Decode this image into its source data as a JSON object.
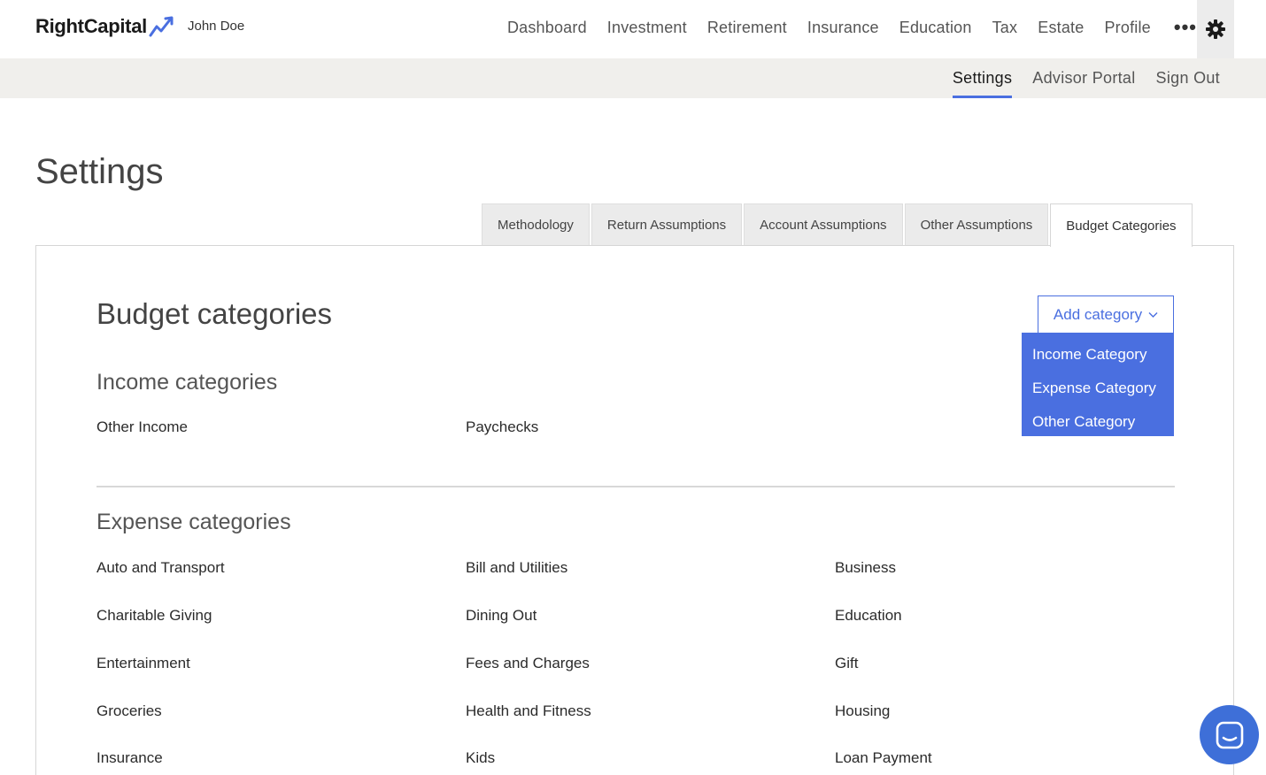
{
  "header": {
    "brand": "RightCapital",
    "user": "John Doe",
    "nav": [
      "Dashboard",
      "Investment",
      "Retirement",
      "Insurance",
      "Education",
      "Tax",
      "Estate",
      "Profile"
    ],
    "more_icon": "more-horizontal-icon",
    "settings_icon": "gear-icon"
  },
  "subnav": {
    "items": [
      "Settings",
      "Advisor Portal",
      "Sign Out"
    ],
    "active": "Settings"
  },
  "page": {
    "title": "Settings"
  },
  "tabs": [
    "Methodology",
    "Return Assumptions",
    "Account Assumptions",
    "Other Assumptions",
    "Budget Categories"
  ],
  "active_tab": "Budget Categories",
  "budget": {
    "title": "Budget categories",
    "add_button": "Add category",
    "dropdown": [
      "Income Category",
      "Expense Category",
      "Other Category"
    ],
    "income_title": "Income categories",
    "income": [
      "Other Income",
      "Paychecks"
    ],
    "expense_title": "Expense categories",
    "expense": [
      "Auto and Transport",
      "Bill and Utilities",
      "Business",
      "Charitable Giving",
      "Dining Out",
      "Education",
      "Entertainment",
      "Fees and Charges",
      "Gift",
      "Groceries",
      "Health and Fitness",
      "Housing",
      "Insurance",
      "Kids",
      "Loan Payment"
    ]
  },
  "colors": {
    "accent": "#4a6fe0",
    "subbar_bg": "#f0efec",
    "chat": "#3e6fd8"
  },
  "chat_icon": "chat-icon"
}
